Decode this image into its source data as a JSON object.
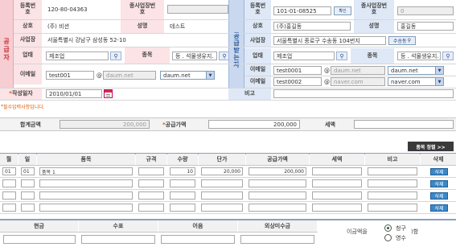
{
  "supplier": {
    "sidebar_label": "공급자",
    "reg_no_label": "등록번호",
    "reg_no": "120-80-04363",
    "branch_label": "종사업장번호",
    "branch": "",
    "name_label": "상호",
    "name": "(주) 비션",
    "ceo_label": "성명",
    "ceo": "테스트",
    "addr_label": "사업장",
    "addr": "서울특별시 강남구 삼성동 52-10",
    "biz_type_label": "업태",
    "biz_type": "제조업",
    "item_label": "종목",
    "item": "등 . 석물생유지.",
    "email_label": "이메일",
    "email_id": "test001",
    "email_domain": "daum.net",
    "email_select": "daum.net"
  },
  "receiver": {
    "sidebar_label": "공급받는자",
    "reg_no_label": "등록번호",
    "reg_no": "101-01-08525",
    "confirm_label": "확인",
    "branch_label": "종사업장번호",
    "branch": "0",
    "name_label": "상호",
    "name": "(주)홍길동",
    "ceo_label": "성명",
    "ceo": "홍길동",
    "addr_label": "사업장",
    "addr": "서울특별시 종로구 수송동 104번지",
    "lookup_label": "수송동",
    "biz_type_label": "업태",
    "biz_type": "제조업",
    "item_label": "종목",
    "item": "등 . 석물생유지.",
    "email_label": "이메일",
    "email_id": "test0001",
    "email_domain": "daum.net",
    "email_select": "daum.net",
    "email2_label": "이메일",
    "email2_id": "test0002",
    "email2_domain": "naver.com",
    "email2_select": "naver.com"
  },
  "write_date_label": "작성일자",
  "write_date": "2010/01/01",
  "memo_label": "비고",
  "memo": "",
  "required_note": "필수입력사항입니다.",
  "totals": {
    "total_label": "합계금액",
    "total": "200,000",
    "supply_label": "공급가액",
    "supply": "200,000",
    "tax_label": "세액",
    "tax": ""
  },
  "sort_button": "품목 정렬 >>",
  "table": {
    "headers": [
      "월",
      "일",
      "품목",
      "규격",
      "수량",
      "단가",
      "공급가액",
      "세액",
      "비고",
      "삭제"
    ],
    "delete_label": "삭제",
    "rows": [
      [
        "01",
        "01",
        "품목 1",
        "",
        "10",
        "20,000",
        "200,000",
        "",
        ""
      ],
      [
        "",
        "",
        "",
        "",
        "",
        "",
        "",
        "",
        ""
      ],
      [
        "",
        "",
        "",
        "",
        "",
        "",
        "",
        "",
        ""
      ],
      [
        "",
        "",
        "",
        "",
        "",
        "",
        "",
        "",
        ""
      ]
    ]
  },
  "payment": {
    "headers": [
      "현금",
      "수표",
      "어음",
      "외상미수금"
    ],
    "receipt_prefix": "이금액을",
    "receipt_suffix": ")함",
    "option_claim": "청구",
    "option_receipt": "영수"
  },
  "colors": {
    "supplier_label_bg": "#fbe3e6",
    "receiver_label_bg": "#dfe8f6",
    "supplier_sidebar": "#c8323c",
    "receiver_sidebar": "#2d5a9c",
    "button_blue": "#3a88c8"
  }
}
